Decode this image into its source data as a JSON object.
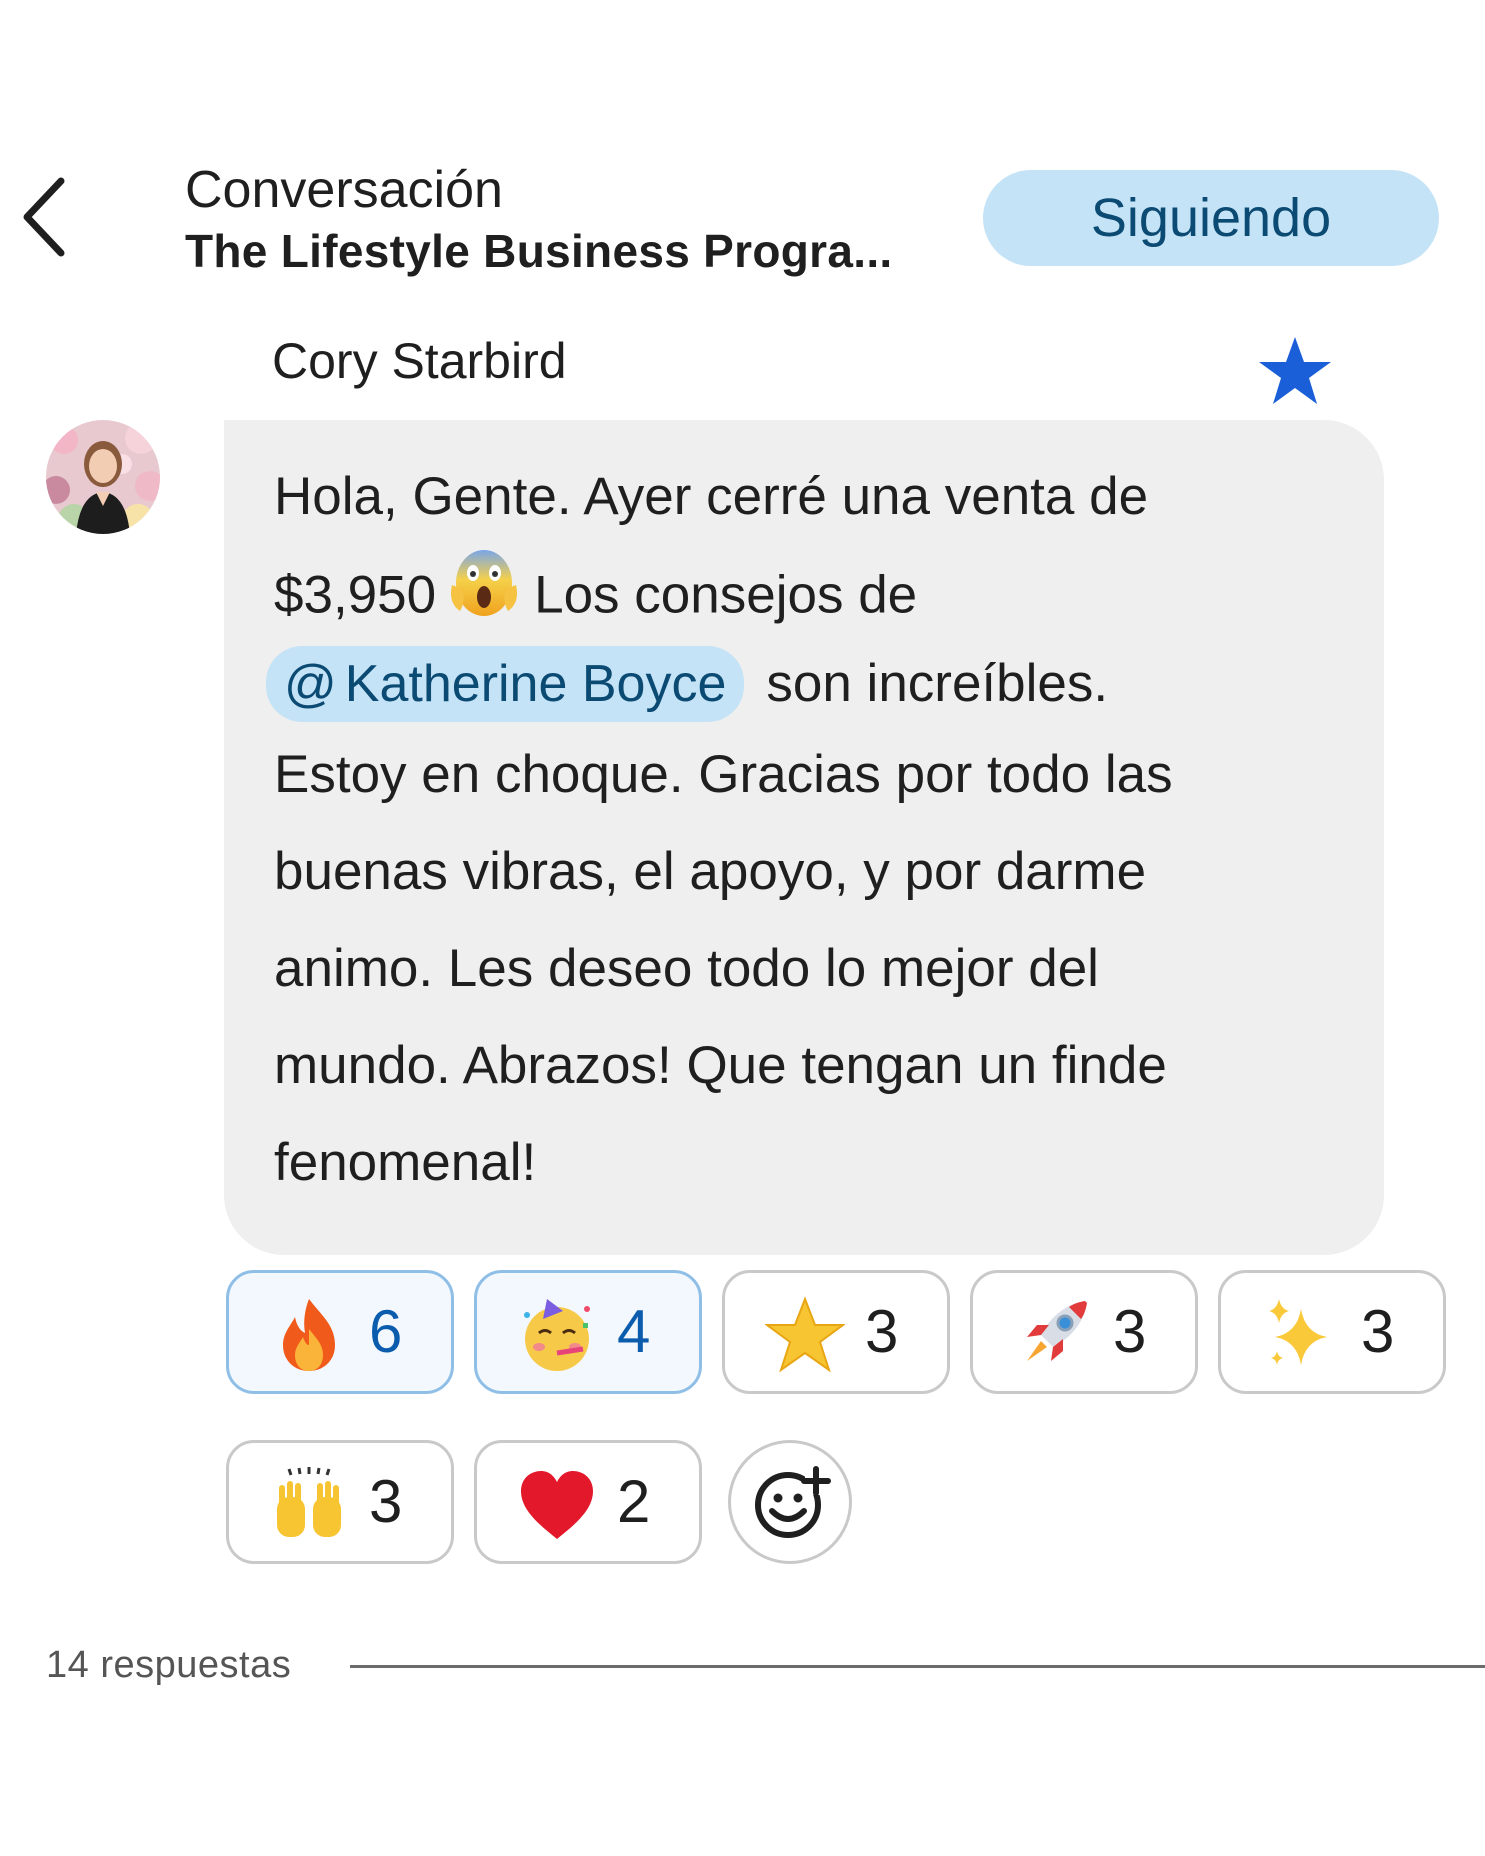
{
  "header": {
    "title": "Conversación",
    "subtitle": "The Lifestyle Business Progra...",
    "follow_label": "Siguiendo"
  },
  "post": {
    "author": "Cory Starbird",
    "message_lines": {
      "l1": "Hola, Gente. Ayer cerré una venta de",
      "l2a": "$3,950",
      "l2b": "Los consejos de",
      "mention_at": "@",
      "mention": "Katherine Boyce",
      "l3b": "son increíbles.",
      "l4": "Estoy en choque. Gracias por todo las",
      "l5": "buenas vibras, el apoyo, y por darme",
      "l6": "animo. Les deseo todo lo mejor del",
      "l7": "mundo. Abrazos! Que tengan un finde",
      "l8": "fenomenal!"
    },
    "inline_emoji": "face-screaming-in-fear-emoji"
  },
  "reactions": [
    {
      "emoji": "fire-emoji",
      "count": "6",
      "active": true
    },
    {
      "emoji": "partying-face-emoji",
      "count": "4",
      "active": true
    },
    {
      "emoji": "star-emoji",
      "count": "3",
      "active": false
    },
    {
      "emoji": "rocket-emoji",
      "count": "3",
      "active": false
    },
    {
      "emoji": "sparkles-emoji",
      "count": "3",
      "active": false
    },
    {
      "emoji": "raising-hands-emoji",
      "count": "3",
      "active": false
    },
    {
      "emoji": "red-heart-emoji",
      "count": "2",
      "active": false
    }
  ],
  "replies": {
    "label": "14 respuestas"
  },
  "colors": {
    "accent_bg": "#c4e3f7",
    "accent_text": "#0b4a72",
    "star": "#1a5fd8",
    "bubble": "#efefef"
  }
}
